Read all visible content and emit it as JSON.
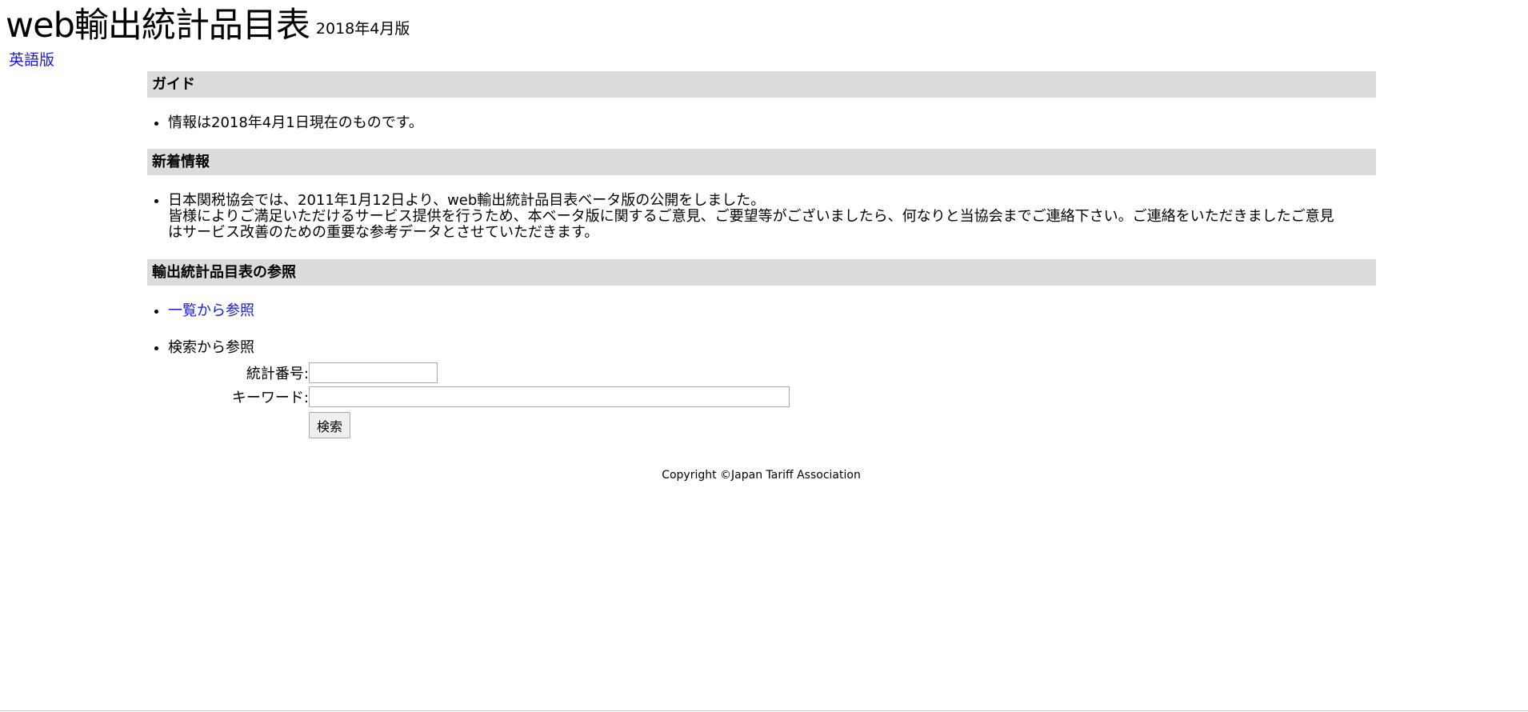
{
  "header": {
    "title": "web輸出統計品目表",
    "edition": "2018年4月版",
    "lang_link": "英語版"
  },
  "guide": {
    "heading": "ガイド",
    "items": [
      "情報は2018年4月1日現在のものです。"
    ]
  },
  "news": {
    "heading": "新着情報",
    "line1": "日本関税協会では、2011年1月12日より、web輸出統計品目表ベータ版の公開をしました。",
    "line2": "皆様によりご満足いただけるサービス提供を行うため、本ベータ版に関するご意見、ご要望等がございましたら、何なりと当協会までご連絡下さい。ご連絡をいただきましたご意見",
    "line3": "はサービス改善のための重要な参考データとさせていただきます。"
  },
  "reference": {
    "heading": "輸出統計品目表の参照",
    "list_link": "一覧から参照",
    "search_label": "検索から参照",
    "stat_number_label": "統計番号:",
    "stat_number_value": "",
    "keyword_label": "キーワード:",
    "keyword_value": "",
    "search_button": "検索"
  },
  "footer": {
    "copyright": "Copyright ©Japan Tariff Association"
  }
}
